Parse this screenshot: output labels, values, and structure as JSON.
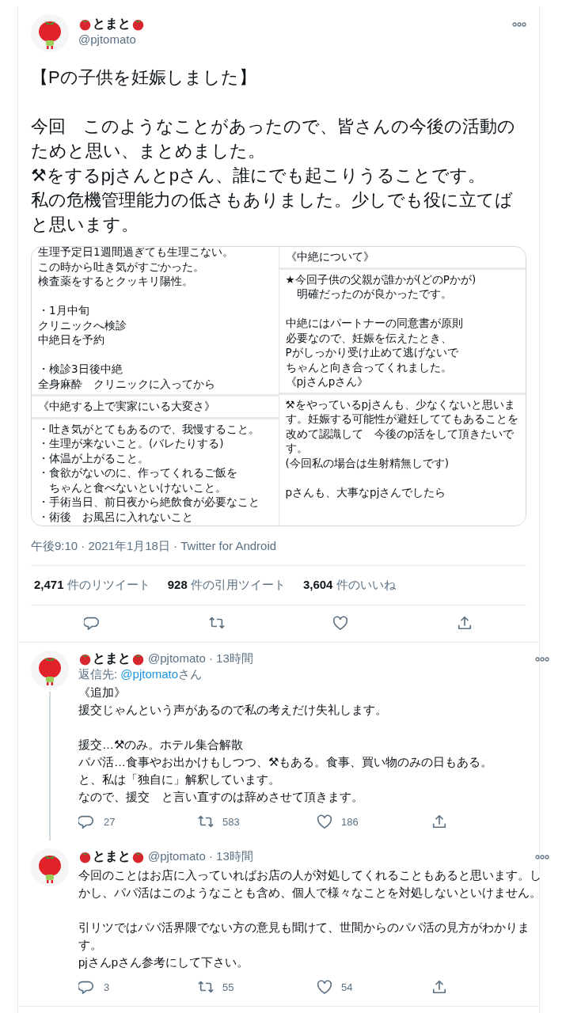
{
  "tweet": {
    "author": {
      "name": "とまと",
      "handle": "@pjtomato"
    },
    "paragraphs": [
      [
        "【Pの子供を妊娠しました】"
      ],
      [
        "今回　このようなことがあったので、皆さんの今後の活動のためと思い、まとめました。",
        "⚒をするpjさんとpさん、誰にでも起こりうることです。",
        "私の危機管理能力の低さもありました。少しでも役に立てばと思います。"
      ]
    ],
    "media": {
      "columns": [
        {
          "panels": [
            {
              "paragraphs": [
                [
                  "生理予定日1週間過ぎても生理こない。",
                  "この時から吐き気がすごかった。",
                  "検査薬をするとクッキリ陽性。"
                ],
                [
                  "・1月中旬",
                  "クリニックへ検診",
                  "中絶日を予約"
                ],
                [
                  "・検診3日後中絶",
                  "全身麻酔　クリニックに入ってから"
                ]
              ]
            },
            {
              "paragraphs": [
                [
                  "《中絶する上で実家にいる大変さ》"
                ]
              ]
            },
            {
              "paragraphs": [
                [
                  "・吐き気がとてもあるので、我慢すること。",
                  "・生理が来ないこと。(バレたりする)",
                  "・体温が上がること。",
                  "・食欲がないのに、作ってくれるご飯を",
                  "　ちゃんと食べないといけないこと。",
                  "・手術当日、前日夜から絶飲食が必要なこと",
                  "・術後　お風呂に入れないこと"
                ]
              ]
            }
          ]
        },
        {
          "panels": [
            {
              "paragraphs": [
                [
                  "《中絶について》"
                ]
              ]
            },
            {
              "paragraphs": [
                [
                  "★今回子供の父親が誰かが(どのPかが)",
                  "　明確だったのが良かったです。"
                ],
                [
                  "中絶にはパートナーの同意書が原則",
                  "必要なので、妊娠を伝えたとき、",
                  "Pがしっかり受け止めて逃げないで",
                  "ちゃんと向き合ってくれました。",
                  "《pjさんpさん》"
                ]
              ]
            },
            {
              "paragraphs": [
                [
                  "⚒をやっているpjさんも、少なくないと思います。妊娠する可能性が避妊しててもあることを改めて認識して　今後のp活をして頂きたいです。",
                  "(今回私の場合は生射精無しです)"
                ],
                [
                  "pさんも、大事なpjさんでしたら"
                ]
              ]
            }
          ]
        }
      ]
    },
    "meta": "午後9:10 · 2021年1月18日 · Twitter for Android",
    "stats": [
      {
        "count": "2,471",
        "label": "件のリツイート"
      },
      {
        "count": "928",
        "label": "件の引用ツイート"
      },
      {
        "count": "3,604",
        "label": "件のいいね"
      }
    ]
  },
  "replies": [
    {
      "name": "とまと",
      "byline": "@pjtomato · 13時間",
      "thread_line": true,
      "reply_to": {
        "prefix": "返信先: ",
        "mention": "@pjtomato",
        "suffix": "さん"
      },
      "paragraphs": [
        [
          "《追加》",
          "援交じゃんという声があるので私の考えだけ失礼します。"
        ],
        [
          "援交…⚒のみ。ホテル集合解散",
          "パパ活…食事やお出かけもしつつ、⚒もある。食事、買い物のみの日もある。",
          "と、私は「独自に」解釈しています。",
          "なので、援交　と言い直すのは辞めさせて頂きます。"
        ]
      ],
      "counts": {
        "replies": "27",
        "retweets": "583",
        "likes": "186"
      }
    },
    {
      "name": "とまと",
      "byline": "@pjtomato · 13時間",
      "thread_line": false,
      "paragraphs": [
        [
          "今回のことはお店に入っていればお店の人が対処してくれることもあると思います。しかし、パパ活はこのようなことも含め、個人で様々なことを対処しないといけません。"
        ],
        [
          "引リツではパパ活界隈でない方の意見も聞けて、世間からのパパ活の見方がわかります。",
          "pjさんpさん参考にして下さい。"
        ]
      ],
      "counts": {
        "replies": "3",
        "retweets": "55",
        "likes": "54"
      }
    }
  ]
}
